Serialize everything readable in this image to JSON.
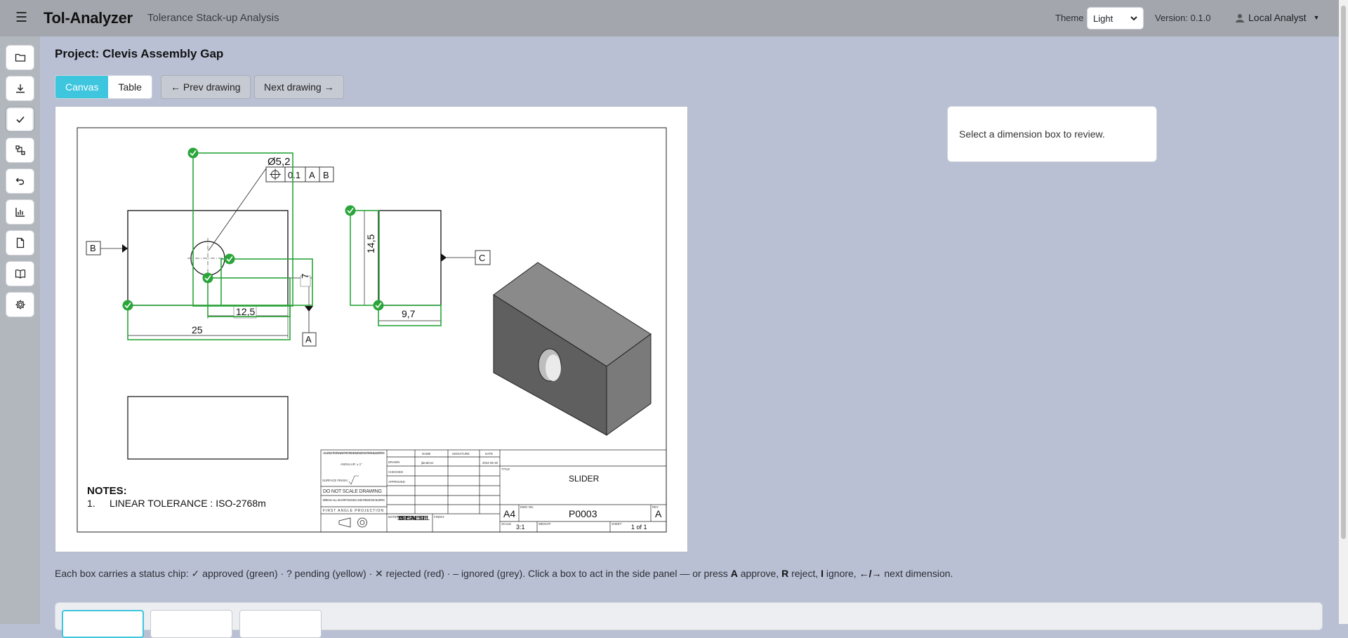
{
  "app": {
    "menu_icon": "hamburger-icon",
    "brand": "Tol-Analyzer",
    "subtitle": "Tolerance Stack-up Analysis",
    "theme_label": "Theme",
    "theme_value": "Light",
    "version": "Version: 0.1.0",
    "user": "Local Analyst"
  },
  "rail": [
    {
      "name": "open-folder-icon"
    },
    {
      "name": "download-icon"
    },
    {
      "name": "check-icon"
    },
    {
      "name": "stack-icon"
    },
    {
      "name": "undo-icon"
    },
    {
      "name": "chart-icon"
    },
    {
      "name": "document-icon"
    },
    {
      "name": "book-icon"
    },
    {
      "name": "settings-icon"
    }
  ],
  "main": {
    "project_title": "Project: Clevis Assembly Gap",
    "view_canvas": "Canvas",
    "view_table": "Table",
    "prev": "← Prev drawing",
    "next": "Next drawing →",
    "side_panel": "Select a dimension box to review.",
    "help_pre": "Each box carries a status chip: ✓ approved (green) · ? pending (yellow) · ✕ rejected (red) · – ignored (grey). Click a box to act in the side panel — or press ",
    "help_a": "A",
    "help_mid1": " approve, ",
    "help_r": "R",
    "help_mid2": " reject, ",
    "help_i": "I",
    "help_mid3": " ignore, ",
    "help_arrows": "←/→",
    "help_post": " next dimension."
  },
  "drawing": {
    "dim_diameter": "Ø5,2",
    "fcf_tol": "0.1",
    "fcf_a": "A",
    "fcf_b": "B",
    "datum_b": "B",
    "datum_a": "A",
    "datum_c": "C",
    "dim_7": "7",
    "dim_12_5": "12,5",
    "dim_25": "25",
    "dim_14_5": "14,5",
    "dim_9_7": "9,7",
    "notes_title": "NOTES:",
    "note_1_num": "1.",
    "note_1": "LINEAR TOLERANCE : ISO-2768m",
    "tb_general": "UNLESS OTHERWISE SPECIFIED: DIMENSIONS ARE IN MILLIMETERS",
    "tb_angular": "ANGULAR: ± 1°",
    "tb_surface": "SURFACE FINISH:",
    "tb_noscale": "DO NOT SCALE DRAWING",
    "tb_break": "BREAK ALL SHARP EDGES AND REMOVE BURRS",
    "tb_projection": "FIRST ANGLE PROJECTION",
    "tb_name": "NAME",
    "tb_signature": "SIGNATURE",
    "tb_date": "DATE",
    "tb_drawn": "DRAWN",
    "tb_checked": "CHECKED",
    "tb_approved": "APPROVED",
    "tb_drawn_by": "jlanderos",
    "tb_drawn_date": "2024-05-30",
    "tb_material_lbl": "MATERIAL:",
    "tb_material": "300 SERIES STAINLESS STEEL",
    "tb_finish_lbl": "FINISH:",
    "tb_title_lbl": "TITLE:",
    "tb_title": "SLIDER",
    "tb_size": "A4",
    "tb_dwgno_lbl": "DWG NO.",
    "tb_dwgno": "P0003",
    "tb_rev_lbl": "REV",
    "tb_rev": "A",
    "tb_scale_lbl": "SCALE",
    "tb_scale": "3:1",
    "tb_weight_lbl": "WEIGHT:",
    "tb_sheet_lbl": "SHEET",
    "tb_sheet": "1 of 1"
  },
  "colors": {
    "accent": "#3ec6de",
    "approved": "#2aa53a"
  }
}
